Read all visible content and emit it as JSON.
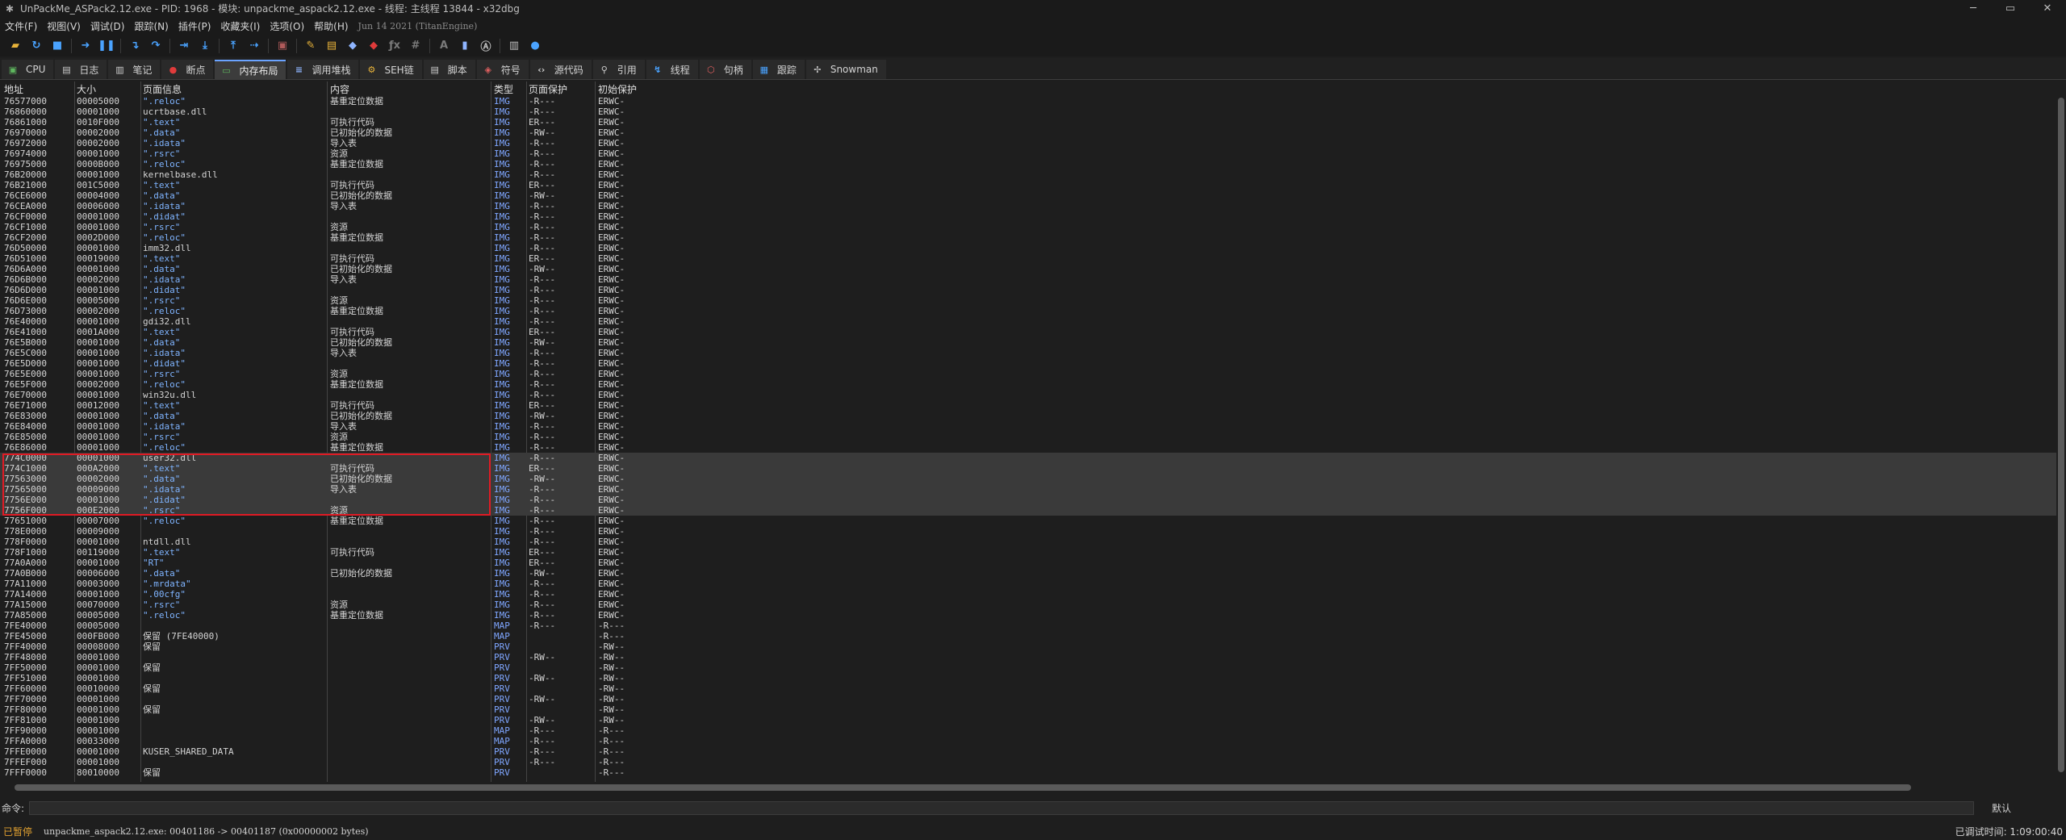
{
  "window": {
    "title": "UnPackMe_ASPack2.12.exe - PID: 1968 - 模块: unpackme_aspack2.12.exe - 线程: 主线程 13844 - x32dbg",
    "app_icon": "bug-icon",
    "controls": [
      "minimize-icon",
      "maximize-icon",
      "close-icon"
    ]
  },
  "menu": {
    "items": [
      "文件(F)",
      "视图(V)",
      "调试(D)",
      "跟踪(N)",
      "插件(P)",
      "收藏夹(I)",
      "选项(O)",
      "帮助(H)"
    ],
    "build_date": "Jun 14 2021 (TitanEngine)"
  },
  "toolbar": {
    "buttons": [
      {
        "name": "open-icon",
        "glyph": "▰",
        "color": "#e8b33a"
      },
      {
        "name": "restart-icon",
        "glyph": "↻",
        "color": "#4aa3ff"
      },
      {
        "name": "stop-icon",
        "glyph": "■",
        "color": "#4aa3ff"
      },
      {
        "name": "sep"
      },
      {
        "name": "run-icon",
        "glyph": "➜",
        "color": "#4aa3ff"
      },
      {
        "name": "pause-icon",
        "glyph": "❚❚",
        "color": "#4aa3ff"
      },
      {
        "name": "sep"
      },
      {
        "name": "step-into-icon",
        "glyph": "↴",
        "color": "#4aa3ff"
      },
      {
        "name": "step-over-icon",
        "glyph": "↷",
        "color": "#4aa3ff"
      },
      {
        "name": "sep"
      },
      {
        "name": "trace-into-icon",
        "glyph": "⇥",
        "color": "#4aa3ff"
      },
      {
        "name": "trace-over-icon",
        "glyph": "⤓",
        "color": "#4aa3ff"
      },
      {
        "name": "sep"
      },
      {
        "name": "execute-till-return-icon",
        "glyph": "⤒",
        "color": "#4aa3ff"
      },
      {
        "name": "run-to-user-code-icon",
        "glyph": "⇢",
        "color": "#4aa3ff"
      },
      {
        "name": "sep"
      },
      {
        "name": "script-icon",
        "glyph": "▣",
        "color": "#b05a5a"
      },
      {
        "name": "sep"
      },
      {
        "name": "comment-icon",
        "glyph": "✎",
        "color": "#e8b33a"
      },
      {
        "name": "label-icon",
        "glyph": "▤",
        "color": "#e8b33a"
      },
      {
        "name": "bookmark-icon",
        "glyph": "◆",
        "color": "#8fb5ff"
      },
      {
        "name": "function-icon",
        "glyph": "◆",
        "color": "#e03b3b"
      },
      {
        "name": "patch-icon",
        "glyph": "ƒx",
        "color": "#7a7a7a"
      },
      {
        "name": "hash-icon",
        "glyph": "#",
        "color": "#7a7a7a"
      },
      {
        "name": "sep"
      },
      {
        "name": "font-icon",
        "glyph": "A",
        "color": "#7a7a7a"
      },
      {
        "name": "calculator-icon",
        "glyph": "▮",
        "color": "#8fb5ff"
      },
      {
        "name": "strings-icon",
        "glyph": "Ⓐ",
        "color": "#c0c0c0"
      },
      {
        "name": "sep"
      },
      {
        "name": "notes-icon",
        "glyph": "▥",
        "color": "#c0c0c0"
      },
      {
        "name": "help-icon",
        "glyph": "●",
        "color": "#4aa3ff"
      }
    ]
  },
  "tabs": [
    {
      "label": "CPU",
      "icon": "cpu-icon",
      "glyph": "▣",
      "color": "#5fb85f"
    },
    {
      "label": "日志",
      "icon": "log-icon",
      "glyph": "▤",
      "color": "#cfcfcf"
    },
    {
      "label": "笔记",
      "icon": "notes-icon",
      "glyph": "▥",
      "color": "#cfcfcf"
    },
    {
      "label": "断点",
      "icon": "breakpoint-icon",
      "glyph": "●",
      "color": "#e03b3b"
    },
    {
      "label": "内存布局",
      "icon": "memory-map-icon",
      "glyph": "▭",
      "color": "#5fb85f",
      "active": true
    },
    {
      "label": "调用堆栈",
      "icon": "call-stack-icon",
      "glyph": "≡",
      "color": "#8fb5ff"
    },
    {
      "label": "SEH链",
      "icon": "seh-icon",
      "glyph": "⚙",
      "color": "#e8b33a"
    },
    {
      "label": "脚本",
      "icon": "script-icon",
      "glyph": "▤",
      "color": "#cfcfcf"
    },
    {
      "label": "符号",
      "icon": "symbol-icon",
      "glyph": "◈",
      "color": "#e06060"
    },
    {
      "label": "源代码",
      "icon": "source-icon",
      "glyph": "‹›",
      "color": "#cfcfcf"
    },
    {
      "label": "引用",
      "icon": "references-icon",
      "glyph": "⚲",
      "color": "#cfcfcf"
    },
    {
      "label": "线程",
      "icon": "threads-icon",
      "glyph": "↯",
      "color": "#4aa3ff"
    },
    {
      "label": "句柄",
      "icon": "handles-icon",
      "glyph": "⬡",
      "color": "#e06060"
    },
    {
      "label": "跟踪",
      "icon": "trace-icon",
      "glyph": "▦",
      "color": "#4aa3ff"
    },
    {
      "label": "Snowman",
      "icon": "snowman-icon",
      "glyph": "✢",
      "color": "#cfcfcf"
    }
  ],
  "memory_map": {
    "columns": [
      "地址",
      "大小",
      "页面信息",
      "内容",
      "类型",
      "页面保护",
      "初始保护"
    ],
    "rows": [
      [
        "76577000",
        "00005000",
        "\".reloc\"",
        "基重定位数据",
        "IMG",
        "-R---",
        "ERWC-"
      ],
      [
        "76860000",
        "00001000",
        "ucrtbase.dll",
        "",
        "IMG",
        "-R---",
        "ERWC-"
      ],
      [
        "76861000",
        "0010F000",
        "\".text\"",
        "可执行代码",
        "IMG",
        "ER---",
        "ERWC-"
      ],
      [
        "76970000",
        "00002000",
        "\".data\"",
        "已初始化的数据",
        "IMG",
        "-RW--",
        "ERWC-"
      ],
      [
        "76972000",
        "00002000",
        "\".idata\"",
        "导入表",
        "IMG",
        "-R---",
        "ERWC-"
      ],
      [
        "76974000",
        "00001000",
        "\".rsrc\"",
        "资源",
        "IMG",
        "-R---",
        "ERWC-"
      ],
      [
        "76975000",
        "0000B000",
        "\".reloc\"",
        "基重定位数据",
        "IMG",
        "-R---",
        "ERWC-"
      ],
      [
        "76B20000",
        "00001000",
        "kernelbase.dll",
        "",
        "IMG",
        "-R---",
        "ERWC-"
      ],
      [
        "76B21000",
        "001C5000",
        "\".text\"",
        "可执行代码",
        "IMG",
        "ER---",
        "ERWC-"
      ],
      [
        "76CE6000",
        "00004000",
        "\".data\"",
        "已初始化的数据",
        "IMG",
        "-RW--",
        "ERWC-"
      ],
      [
        "76CEA000",
        "00006000",
        "\".idata\"",
        "导入表",
        "IMG",
        "-R---",
        "ERWC-"
      ],
      [
        "76CF0000",
        "00001000",
        "\".didat\"",
        "",
        "IMG",
        "-R---",
        "ERWC-"
      ],
      [
        "76CF1000",
        "00001000",
        "\".rsrc\"",
        "资源",
        "IMG",
        "-R---",
        "ERWC-"
      ],
      [
        "76CF2000",
        "0002D000",
        "\".reloc\"",
        "基重定位数据",
        "IMG",
        "-R---",
        "ERWC-"
      ],
      [
        "76D50000",
        "00001000",
        "imm32.dll",
        "",
        "IMG",
        "-R---",
        "ERWC-"
      ],
      [
        "76D51000",
        "00019000",
        "\".text\"",
        "可执行代码",
        "IMG",
        "ER---",
        "ERWC-"
      ],
      [
        "76D6A000",
        "00001000",
        "\".data\"",
        "已初始化的数据",
        "IMG",
        "-RW--",
        "ERWC-"
      ],
      [
        "76D6B000",
        "00002000",
        "\".idata\"",
        "导入表",
        "IMG",
        "-R---",
        "ERWC-"
      ],
      [
        "76D6D000",
        "00001000",
        "\".didat\"",
        "",
        "IMG",
        "-R---",
        "ERWC-"
      ],
      [
        "76D6E000",
        "00005000",
        "\".rsrc\"",
        "资源",
        "IMG",
        "-R---",
        "ERWC-"
      ],
      [
        "76D73000",
        "00002000",
        "\".reloc\"",
        "基重定位数据",
        "IMG",
        "-R---",
        "ERWC-"
      ],
      [
        "76E40000",
        "00001000",
        "gdi32.dll",
        "",
        "IMG",
        "-R---",
        "ERWC-"
      ],
      [
        "76E41000",
        "0001A000",
        "\".text\"",
        "可执行代码",
        "IMG",
        "ER---",
        "ERWC-"
      ],
      [
        "76E5B000",
        "00001000",
        "\".data\"",
        "已初始化的数据",
        "IMG",
        "-RW--",
        "ERWC-"
      ],
      [
        "76E5C000",
        "00001000",
        "\".idata\"",
        "导入表",
        "IMG",
        "-R---",
        "ERWC-"
      ],
      [
        "76E5D000",
        "00001000",
        "\".didat\"",
        "",
        "IMG",
        "-R---",
        "ERWC-"
      ],
      [
        "76E5E000",
        "00001000",
        "\".rsrc\"",
        "资源",
        "IMG",
        "-R---",
        "ERWC-"
      ],
      [
        "76E5F000",
        "00002000",
        "\".reloc\"",
        "基重定位数据",
        "IMG",
        "-R---",
        "ERWC-"
      ],
      [
        "76E70000",
        "00001000",
        "win32u.dll",
        "",
        "IMG",
        "-R---",
        "ERWC-"
      ],
      [
        "76E71000",
        "00012000",
        "\".text\"",
        "可执行代码",
        "IMG",
        "ER---",
        "ERWC-"
      ],
      [
        "76E83000",
        "00001000",
        "\".data\"",
        "已初始化的数据",
        "IMG",
        "-RW--",
        "ERWC-"
      ],
      [
        "76E84000",
        "00001000",
        "\".idata\"",
        "导入表",
        "IMG",
        "-R---",
        "ERWC-"
      ],
      [
        "76E85000",
        "00001000",
        "\".rsrc\"",
        "资源",
        "IMG",
        "-R---",
        "ERWC-"
      ],
      [
        "76E86000",
        "00001000",
        "\".reloc\"",
        "基重定位数据",
        "IMG",
        "-R---",
        "ERWC-"
      ],
      [
        "774C0000",
        "00001000",
        "user32.dll",
        "",
        "IMG",
        "-R---",
        "ERWC-",
        true
      ],
      [
        "774C1000",
        "000A2000",
        "\".text\"",
        "可执行代码",
        "IMG",
        "ER---",
        "ERWC-",
        true
      ],
      [
        "77563000",
        "00002000",
        "\".data\"",
        "已初始化的数据",
        "IMG",
        "-RW--",
        "ERWC-",
        true
      ],
      [
        "77565000",
        "00009000",
        "\".idata\"",
        "导入表",
        "IMG",
        "-R---",
        "ERWC-",
        true
      ],
      [
        "7756E000",
        "00001000",
        "\".didat\"",
        "",
        "IMG",
        "-R---",
        "ERWC-",
        true
      ],
      [
        "7756F000",
        "000E2000",
        "\".rsrc\"",
        "资源",
        "IMG",
        "-R---",
        "ERWC-",
        true
      ],
      [
        "77651000",
        "00007000",
        "\".reloc\"",
        "基重定位数据",
        "IMG",
        "-R---",
        "ERWC-"
      ],
      [
        "778E0000",
        "00009000",
        "",
        "",
        "IMG",
        "-R---",
        "ERWC-"
      ],
      [
        "778F0000",
        "00001000",
        "ntdll.dll",
        "",
        "IMG",
        "-R---",
        "ERWC-"
      ],
      [
        "778F1000",
        "00119000",
        "\".text\"",
        "可执行代码",
        "IMG",
        "ER---",
        "ERWC-"
      ],
      [
        "77A0A000",
        "00001000",
        "\"RT\"",
        "",
        "IMG",
        "ER---",
        "ERWC-"
      ],
      [
        "77A0B000",
        "00006000",
        "\".data\"",
        "已初始化的数据",
        "IMG",
        "-RW--",
        "ERWC-"
      ],
      [
        "77A11000",
        "00003000",
        "\".mrdata\"",
        "",
        "IMG",
        "-R---",
        "ERWC-"
      ],
      [
        "77A14000",
        "00001000",
        "\".00cfg\"",
        "",
        "IMG",
        "-R---",
        "ERWC-"
      ],
      [
        "77A15000",
        "00070000",
        "\".rsrc\"",
        "资源",
        "IMG",
        "-R---",
        "ERWC-"
      ],
      [
        "77A85000",
        "00005000",
        "\".reloc\"",
        "基重定位数据",
        "IMG",
        "-R---",
        "ERWC-"
      ],
      [
        "7FE40000",
        "00005000",
        "",
        "",
        "MAP",
        "-R---",
        "-R---"
      ],
      [
        "7FE45000",
        "000FB000",
        "保留 (7FE40000)",
        "",
        "MAP",
        "",
        "-R---"
      ],
      [
        "7FF40000",
        "00008000",
        "保留",
        "",
        "PRV",
        "",
        "-RW--"
      ],
      [
        "7FF48000",
        "00001000",
        "",
        "",
        "PRV",
        "-RW--",
        "-RW--"
      ],
      [
        "7FF50000",
        "00001000",
        "保留",
        "",
        "PRV",
        "",
        "-RW--"
      ],
      [
        "7FF51000",
        "00001000",
        "",
        "",
        "PRV",
        "-RW--",
        "-RW--"
      ],
      [
        "7FF60000",
        "00010000",
        "保留",
        "",
        "PRV",
        "",
        "-RW--"
      ],
      [
        "7FF70000",
        "00001000",
        "",
        "",
        "PRV",
        "-RW--",
        "-RW--"
      ],
      [
        "7FF80000",
        "00001000",
        "保留",
        "",
        "PRV",
        "",
        "-RW--"
      ],
      [
        "7FF81000",
        "00001000",
        "",
        "",
        "PRV",
        "-RW--",
        "-RW--"
      ],
      [
        "7FF90000",
        "00001000",
        "",
        "",
        "MAP",
        "-R---",
        "-R---"
      ],
      [
        "7FFA0000",
        "00033000",
        "",
        "",
        "MAP",
        "-R---",
        "-R---"
      ],
      [
        "7FFE0000",
        "00001000",
        "KUSER_SHARED_DATA",
        "",
        "PRV",
        "-R---",
        "-R---"
      ],
      [
        "7FFEF000",
        "00001000",
        "",
        "",
        "PRV",
        "-R---",
        "-R---"
      ],
      [
        "7FFF0000",
        "80010000",
        "保留",
        "",
        "PRV",
        "",
        "-R---"
      ]
    ]
  },
  "command": {
    "label": "命令:",
    "value": "",
    "default_label": "默认"
  },
  "status": {
    "state": "已暂停",
    "message": "unpackme_aspack2.12.exe: 00401186 -> 00401187 (0x00000002 bytes)",
    "time": "已调试时间: 1:09:00:40"
  }
}
